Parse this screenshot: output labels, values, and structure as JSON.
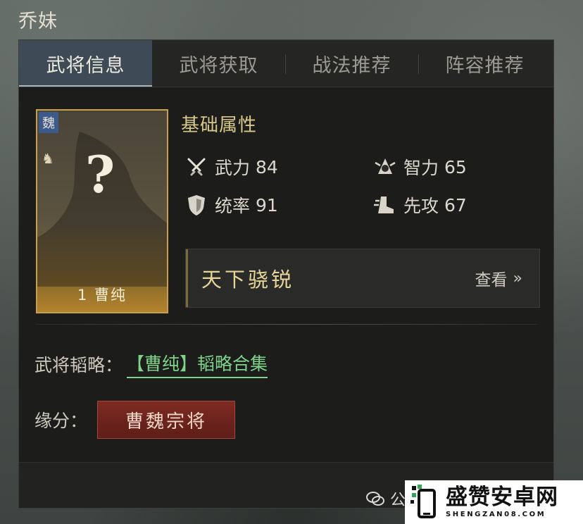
{
  "hero": {
    "name": "乔妹"
  },
  "tabs": [
    {
      "label": "武将信息",
      "active": true
    },
    {
      "label": "武将获取",
      "active": false
    },
    {
      "label": "战法推荐",
      "active": false
    },
    {
      "label": "阵容推荐",
      "active": false
    }
  ],
  "card": {
    "faction_char": "魏",
    "question_mark": "?",
    "cost": "1",
    "name": "曹纯",
    "side_icon": "horse-icon"
  },
  "attributes": {
    "title": "基础属性",
    "stats": [
      {
        "label": "武力",
        "value": "84",
        "icon": "crossed-swords-icon"
      },
      {
        "label": "智力",
        "value": "65",
        "icon": "intellect-icon"
      },
      {
        "label": "统率",
        "value": "91",
        "icon": "shield-icon"
      },
      {
        "label": "先攻",
        "value": "67",
        "icon": "speed-boot-icon"
      }
    ]
  },
  "trait": {
    "name": "天下骁锐",
    "view_label": "查看",
    "view_arrow": "»"
  },
  "strategy": {
    "label": "武将韬略：",
    "link": "【曹纯】韬略合集"
  },
  "fate": {
    "label": "缘分：",
    "badge": "曹魏宗将"
  },
  "watermark": {
    "text": "公众"
  },
  "site_logo": {
    "cn": "盛赞安卓网",
    "en": "SHENGZAN08.COM"
  },
  "colors": {
    "tab_active_bg": "#3e4a55",
    "card_border": "#c9a04a",
    "attr_title": "#d8c88a",
    "link_green": "#7fd28a",
    "fate_red": "#7e2a22",
    "logo_green": "#2fa84f"
  }
}
